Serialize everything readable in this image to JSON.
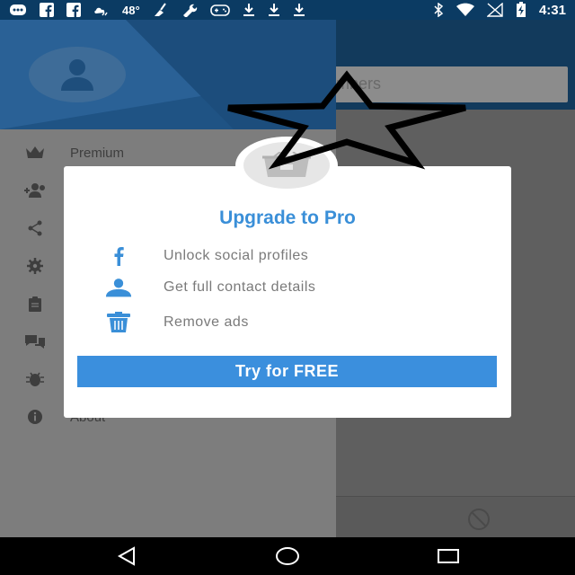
{
  "status_bar": {
    "left_icons": [
      "messages-icon",
      "facebook-icon",
      "facebook-icon",
      "weather-icon"
    ],
    "temperature": "48°",
    "middle_icons": [
      "cleaner-icon",
      "wrench-icon",
      "gamepad-icon",
      "download-icon",
      "download-icon",
      "download-icon"
    ],
    "right_icons": [
      "bluetooth-icon",
      "wifi-icon",
      "no-signal-icon",
      "battery-charging-icon"
    ],
    "time": "4:31"
  },
  "app": {
    "search_text": "mbers"
  },
  "drawer": {
    "items": [
      {
        "label": "Premium",
        "icon": "crown-icon"
      },
      {
        "label": "",
        "icon": "add-group-icon"
      },
      {
        "label": "",
        "icon": "share-icon"
      },
      {
        "label": "",
        "icon": "settings-icon"
      },
      {
        "label": "",
        "icon": "clipboard-icon"
      },
      {
        "label": "",
        "icon": "chat-icon"
      },
      {
        "label": "",
        "icon": "bug-icon"
      },
      {
        "label": "About",
        "icon": "info-icon"
      }
    ]
  },
  "dialog": {
    "title": "Upgrade to Pro",
    "features": [
      {
        "icon": "facebook-icon",
        "text": "Unlock social profiles"
      },
      {
        "icon": "person-icon",
        "text": "Get full contact details"
      },
      {
        "icon": "trash-icon",
        "text": "Remove ads"
      }
    ],
    "cta_label": "Try for FREE"
  },
  "colors": {
    "accent": "#3b8fdd",
    "status_bar": "#0b3b63",
    "drawer_header": "#1f5384"
  }
}
